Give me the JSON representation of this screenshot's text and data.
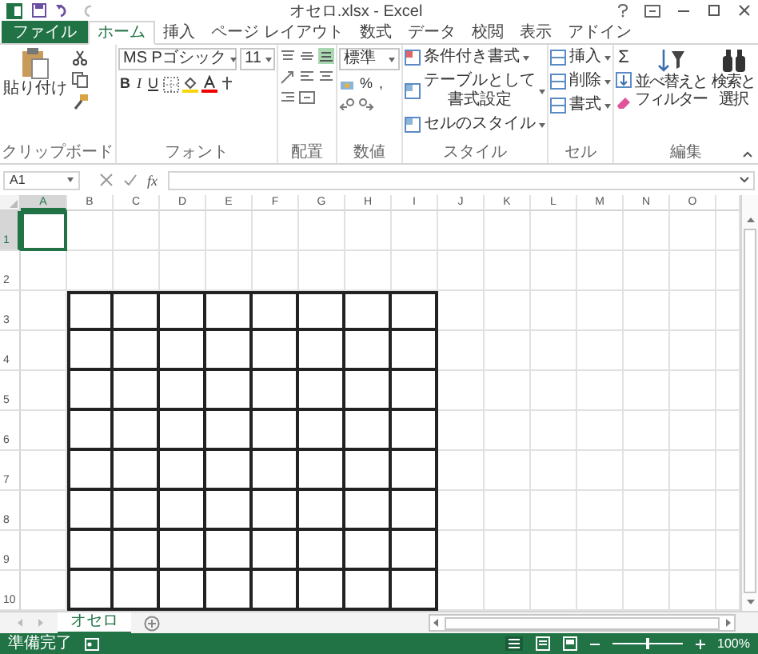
{
  "window": {
    "title": "オセロ.xlsx - Excel"
  },
  "tabs": [
    {
      "label": "ファイル",
      "kind": "file",
      "selected": false
    },
    {
      "label": "ホーム",
      "kind": "tab",
      "selected": true
    },
    {
      "label": "挿入",
      "kind": "tab",
      "selected": false
    },
    {
      "label": "ページ レイアウト",
      "kind": "tab",
      "selected": false
    },
    {
      "label": "数式",
      "kind": "tab",
      "selected": false
    },
    {
      "label": "データ",
      "kind": "tab",
      "selected": false
    },
    {
      "label": "校閲",
      "kind": "tab",
      "selected": false
    },
    {
      "label": "表示",
      "kind": "tab",
      "selected": false
    },
    {
      "label": "アドイン",
      "kind": "tab",
      "selected": false
    }
  ],
  "ribbon": {
    "clipboard": {
      "paste": "貼り付け",
      "label": "クリップボード"
    },
    "font": {
      "name": "MS Pゴシック",
      "size": "11",
      "bold": "B",
      "italic": "I",
      "underline": "U",
      "label": "フォント"
    },
    "alignment": {
      "label": "配置"
    },
    "number": {
      "format": "標準",
      "percent": "%",
      "comma": ",",
      "label": "数値"
    },
    "styles": {
      "items": [
        "条件付き書式",
        "テーブルとして書式設定",
        "セルのスタイル"
      ],
      "label": "スタイル"
    },
    "cells": {
      "items": [
        "挿入",
        "削除",
        "書式"
      ],
      "label": "セル"
    },
    "editing": {
      "sigma": "Σ",
      "sort": [
        "並べ替えと",
        "フィルター"
      ],
      "find": [
        "検索と",
        "選択"
      ],
      "label": "編集"
    }
  },
  "formula_bar": {
    "name_box": "A1",
    "fx": "fx"
  },
  "sheet": {
    "columns": [
      {
        "label": "A",
        "selected": true,
        "bordered": false
      },
      {
        "label": "B",
        "selected": false,
        "bordered": true
      },
      {
        "label": "C",
        "selected": false,
        "bordered": true
      },
      {
        "label": "D",
        "selected": false,
        "bordered": true
      },
      {
        "label": "E",
        "selected": false,
        "bordered": true
      },
      {
        "label": "F",
        "selected": false,
        "bordered": true
      },
      {
        "label": "G",
        "selected": false,
        "bordered": true
      },
      {
        "label": "H",
        "selected": false,
        "bordered": true
      },
      {
        "label": "I",
        "selected": false,
        "bordered": true
      },
      {
        "label": "J",
        "selected": false,
        "bordered": false
      },
      {
        "label": "K",
        "selected": false,
        "bordered": false
      },
      {
        "label": "L",
        "selected": false,
        "bordered": false
      },
      {
        "label": "M",
        "selected": false,
        "bordered": false
      },
      {
        "label": "N",
        "selected": false,
        "bordered": false
      },
      {
        "label": "O",
        "selected": false,
        "bordered": false
      }
    ],
    "rows": [
      {
        "label": "1",
        "selected": true,
        "bordered": false
      },
      {
        "label": "2",
        "selected": false,
        "bordered": false
      },
      {
        "label": "3",
        "selected": false,
        "bordered": true
      },
      {
        "label": "4",
        "selected": false,
        "bordered": true
      },
      {
        "label": "5",
        "selected": false,
        "bordered": true
      },
      {
        "label": "6",
        "selected": false,
        "bordered": true
      },
      {
        "label": "7",
        "selected": false,
        "bordered": true
      },
      {
        "label": "8",
        "selected": false,
        "bordered": true
      },
      {
        "label": "9",
        "selected": false,
        "bordered": true
      },
      {
        "label": "10",
        "selected": false,
        "bordered": true
      }
    ]
  },
  "sheet_tabs": [
    {
      "label": "オセロ",
      "selected": true
    }
  ],
  "status_bar": {
    "status": "準備完了",
    "zoom": {
      "level": 0.5,
      "reading": "100%"
    }
  }
}
